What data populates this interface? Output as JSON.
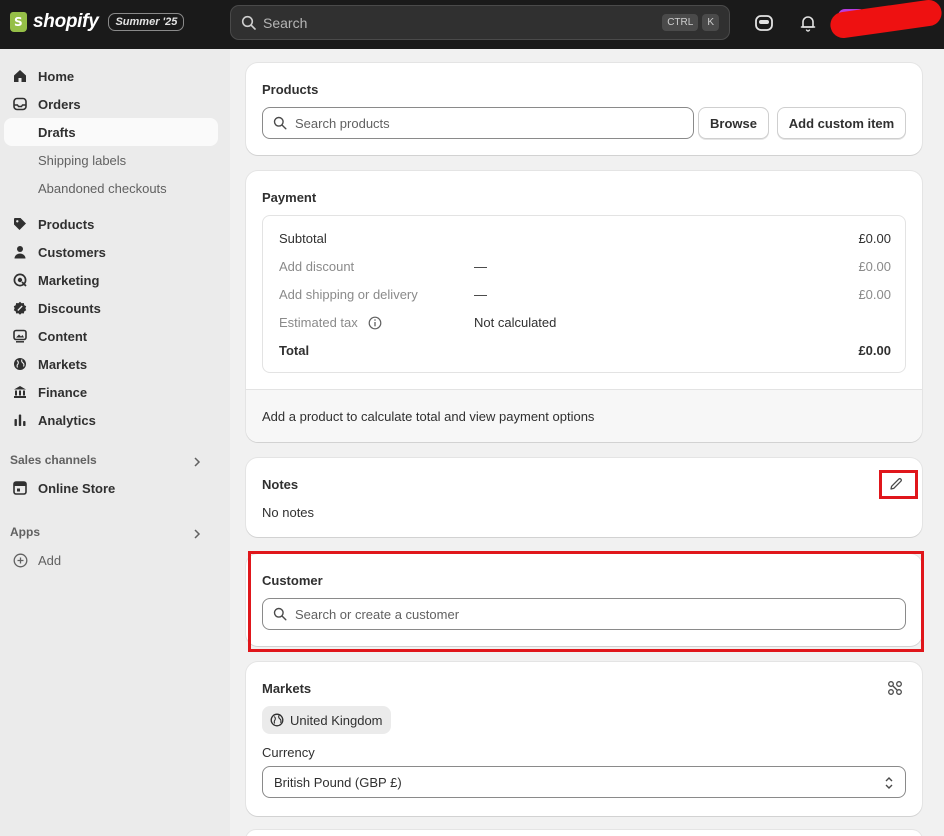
{
  "topbar": {
    "brand": "shopify",
    "edition": "Summer '25",
    "search_placeholder": "Search",
    "shortcut_ctrl": "CTRL",
    "shortcut_k": "K"
  },
  "sidebar": {
    "items": [
      {
        "label": "Home",
        "icon": "home-icon"
      },
      {
        "label": "Orders",
        "icon": "inbox-icon"
      },
      {
        "label": "Drafts",
        "icon": "none"
      },
      {
        "label": "Shipping labels",
        "icon": "none"
      },
      {
        "label": "Abandoned checkouts",
        "icon": "none"
      },
      {
        "label": "Products",
        "icon": "tag-icon"
      },
      {
        "label": "Customers",
        "icon": "person-icon"
      },
      {
        "label": "Marketing",
        "icon": "target-icon"
      },
      {
        "label": "Discounts",
        "icon": "discount-icon"
      },
      {
        "label": "Content",
        "icon": "image-icon"
      },
      {
        "label": "Markets",
        "icon": "globe-icon"
      },
      {
        "label": "Finance",
        "icon": "bank-icon"
      },
      {
        "label": "Analytics",
        "icon": "bar-chart-icon"
      }
    ],
    "sales_channels_label": "Sales channels",
    "online_store": "Online Store",
    "apps_label": "Apps",
    "add_label": "Add"
  },
  "products": {
    "title": "Products",
    "search_placeholder": "Search products",
    "browse": "Browse",
    "add_custom": "Add custom item"
  },
  "payment": {
    "title": "Payment",
    "rows": [
      {
        "label": "Subtotal",
        "detail": "",
        "amount": "£0.00"
      },
      {
        "label": "Add discount",
        "detail": "—",
        "amount": "£0.00"
      },
      {
        "label": "Add shipping or delivery",
        "detail": "—",
        "amount": "£0.00"
      },
      {
        "label": "Estimated tax",
        "detail": "Not calculated",
        "amount": ""
      },
      {
        "label": "Total",
        "detail": "",
        "amount": "£0.00"
      }
    ],
    "footer": "Add a product to calculate total and view payment options"
  },
  "notes": {
    "title": "Notes",
    "body": "No notes"
  },
  "customer": {
    "title": "Customer",
    "search_placeholder": "Search or create a customer"
  },
  "markets": {
    "title": "Markets",
    "market": "United Kingdom",
    "currency_label": "Currency",
    "currency_value": "British Pound (GBP £)"
  },
  "colors": {
    "highlight": "#e0161b",
    "topbar": "#1a1a1a",
    "brand_green": "#95bf47"
  }
}
